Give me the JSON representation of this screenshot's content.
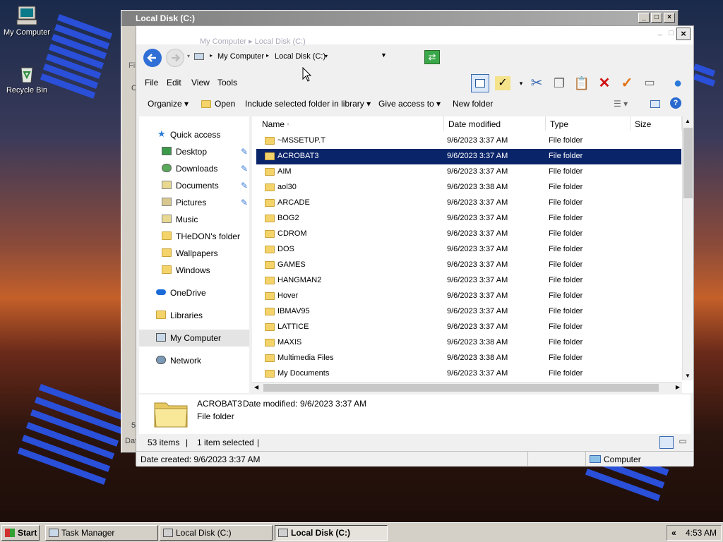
{
  "desktop": {
    "icons": [
      {
        "label": "My Computer",
        "icon": "my-computer-icon"
      },
      {
        "label": "Recycle Bin",
        "icon": "recycle-bin-icon"
      }
    ]
  },
  "back_window": {
    "title": "Local Disk (C:)",
    "side_letters": [
      "Fil",
      "C",
      "5",
      "Dat"
    ]
  },
  "window": {
    "title": "Local Disk (C:)",
    "top_path": "My Computer  ▸  Local Disk (C:)",
    "address": {
      "segments": [
        "My Computer",
        "Local Disk (C:)"
      ]
    },
    "menu": [
      "File",
      "Edit",
      "View",
      "Tools"
    ],
    "commands": {
      "organize": "Organize",
      "open": "Open",
      "include": "Include selected folder in library",
      "share": "Give access to",
      "new_folder": "New folder"
    },
    "nav": [
      {
        "label": "Quick access",
        "icon": "star-icon",
        "pinned": false
      },
      {
        "label": "Desktop",
        "icon": "desktop-icon",
        "pinned": true
      },
      {
        "label": "Downloads",
        "icon": "downloads-icon",
        "pinned": true
      },
      {
        "label": "Documents",
        "icon": "documents-icon",
        "pinned": true
      },
      {
        "label": "Pictures",
        "icon": "pictures-icon",
        "pinned": true
      },
      {
        "label": "Music",
        "icon": "music-icon",
        "pinned": false
      },
      {
        "label": "THeDON's folder",
        "icon": "folder-icon",
        "pinned": false
      },
      {
        "label": "Wallpapers",
        "icon": "folder-icon",
        "pinned": false
      },
      {
        "label": "Windows",
        "icon": "folder-icon",
        "pinned": false
      },
      {
        "label": "OneDrive",
        "icon": "cloud-icon",
        "pinned": false
      },
      {
        "label": "Libraries",
        "icon": "folder-icon",
        "pinned": false
      },
      {
        "label": "My Computer",
        "icon": "computer-icon",
        "pinned": false
      },
      {
        "label": "Network",
        "icon": "network-icon",
        "pinned": false
      }
    ],
    "columns": [
      "Name",
      "Date modified",
      "Type",
      "Size"
    ],
    "files": [
      {
        "name": "~MSSETUP.T",
        "date": "9/6/2023 3:37 AM",
        "type": "File folder"
      },
      {
        "name": "ACROBAT3",
        "date": "9/6/2023 3:37 AM",
        "type": "File folder"
      },
      {
        "name": "AIM",
        "date": "9/6/2023 3:37 AM",
        "type": "File folder"
      },
      {
        "name": "aol30",
        "date": "9/6/2023 3:38 AM",
        "type": "File folder"
      },
      {
        "name": "ARCADE",
        "date": "9/6/2023 3:37 AM",
        "type": "File folder"
      },
      {
        "name": "BOG2",
        "date": "9/6/2023 3:37 AM",
        "type": "File folder"
      },
      {
        "name": "CDROM",
        "date": "9/6/2023 3:37 AM",
        "type": "File folder"
      },
      {
        "name": "DOS",
        "date": "9/6/2023 3:37 AM",
        "type": "File folder"
      },
      {
        "name": "GAMES",
        "date": "9/6/2023 3:37 AM",
        "type": "File folder"
      },
      {
        "name": "HANGMAN2",
        "date": "9/6/2023 3:37 AM",
        "type": "File folder"
      },
      {
        "name": "Hover",
        "date": "9/6/2023 3:37 AM",
        "type": "File folder"
      },
      {
        "name": "IBMAV95",
        "date": "9/6/2023 3:37 AM",
        "type": "File folder"
      },
      {
        "name": "LATTICE",
        "date": "9/6/2023 3:37 AM",
        "type": "File folder"
      },
      {
        "name": "MAXIS",
        "date": "9/6/2023 3:38 AM",
        "type": "File folder"
      },
      {
        "name": "Multimedia Files",
        "date": "9/6/2023 3:38 AM",
        "type": "File folder"
      },
      {
        "name": "My Documents",
        "date": "9/6/2023 3:37 AM",
        "type": "File folder"
      }
    ],
    "selected_index": 1,
    "details": {
      "name": "ACROBAT3",
      "date_label": "Date modified:",
      "date": "9/6/2023 3:37 AM",
      "type": "File folder"
    },
    "status": {
      "count": "53 items",
      "selected": "1 item selected"
    },
    "statusbar": {
      "created": "Date created: 9/6/2023 3:37 AM",
      "zone": "Computer"
    }
  },
  "taskbar": {
    "start": "Start",
    "buttons": [
      {
        "label": "Task Manager",
        "active": false
      },
      {
        "label": "Local Disk (C:)",
        "active": false
      },
      {
        "label": "Local Disk (C:)",
        "active": true
      }
    ],
    "tray_arrow": "«",
    "clock": "4:53 AM"
  },
  "colors": {
    "selection": "#0a246a",
    "ibm_blue": "#2a4fd8",
    "accent": "#3a7bd5"
  }
}
